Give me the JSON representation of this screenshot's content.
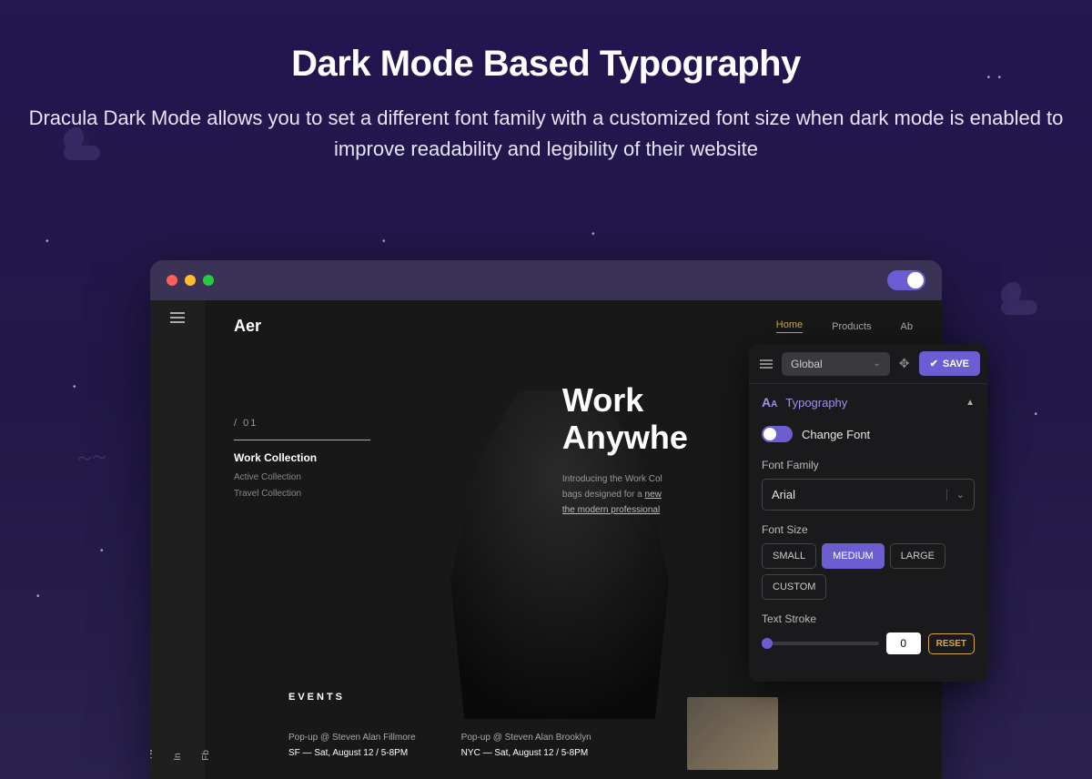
{
  "hero": {
    "title": "Dark Mode Based Typography",
    "subtitle": "Dracula Dark Mode allows you to set a different font family with a customized font size when dark mode is enabled to improve readability and legibility of their website"
  },
  "browser": {
    "toggle_on": true
  },
  "site": {
    "brand": "Aer",
    "nav": {
      "home": "Home",
      "products": "Products",
      "about": "Ab"
    },
    "social": {
      "tw": "Tw",
      "in": "In",
      "fb": "Fb"
    },
    "section_index": "/ 01",
    "section_title": "Work Collection",
    "sublink1": "Active Collection",
    "sublink2": "Travel Collection",
    "headline1": "Work",
    "headline2": "Anywhe",
    "intro_lead": "Introducing the Work Col",
    "intro_line2": "bags designed for a ",
    "intro_u1": "new",
    "intro_u2": "the modern professional",
    "events_label": "EVENTS",
    "event1_line1": "Pop-up @ Steven Alan Fillmore",
    "event1_line2": "SF — Sat, August 12 / 5-8PM",
    "event2_line1": "Pop-up @ Steven Alan Brooklyn",
    "event2_line2": "NYC — Sat, August 12 / 5-8PM"
  },
  "panel": {
    "scope": "Global",
    "save_label": "SAVE",
    "section_title": "Typography",
    "change_font_label": "Change Font",
    "change_font_on": true,
    "font_family_label": "Font Family",
    "font_family_value": "Arial",
    "font_size_label": "Font Size",
    "sizes": {
      "small": "SMALL",
      "medium": "MEDIUM",
      "large": "LARGE",
      "custom": "CUSTOM"
    },
    "size_selected": "MEDIUM",
    "text_stroke_label": "Text Stroke",
    "text_stroke_value": "0",
    "reset_label": "RESET"
  },
  "colors": {
    "accent": "#6c5dd3",
    "warn": "#d9a646"
  }
}
